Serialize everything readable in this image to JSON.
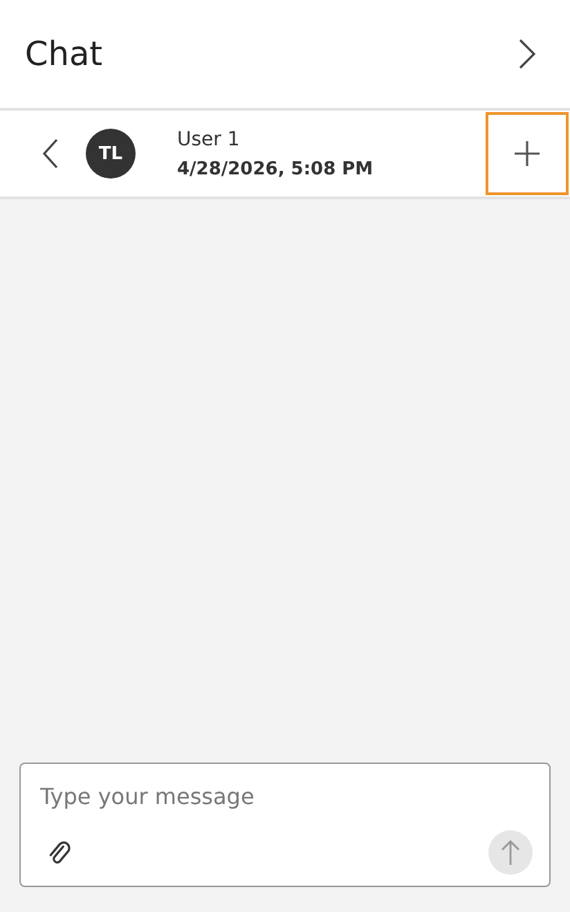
{
  "header": {
    "title": "Chat"
  },
  "conversation": {
    "avatar_initials": "TL",
    "name": "User 1",
    "timestamp": "4/28/2026, 5:08 PM",
    "new_button": {
      "focused": true
    }
  },
  "composer": {
    "placeholder": "Type your message",
    "send_button": {
      "disabled": true
    }
  }
}
